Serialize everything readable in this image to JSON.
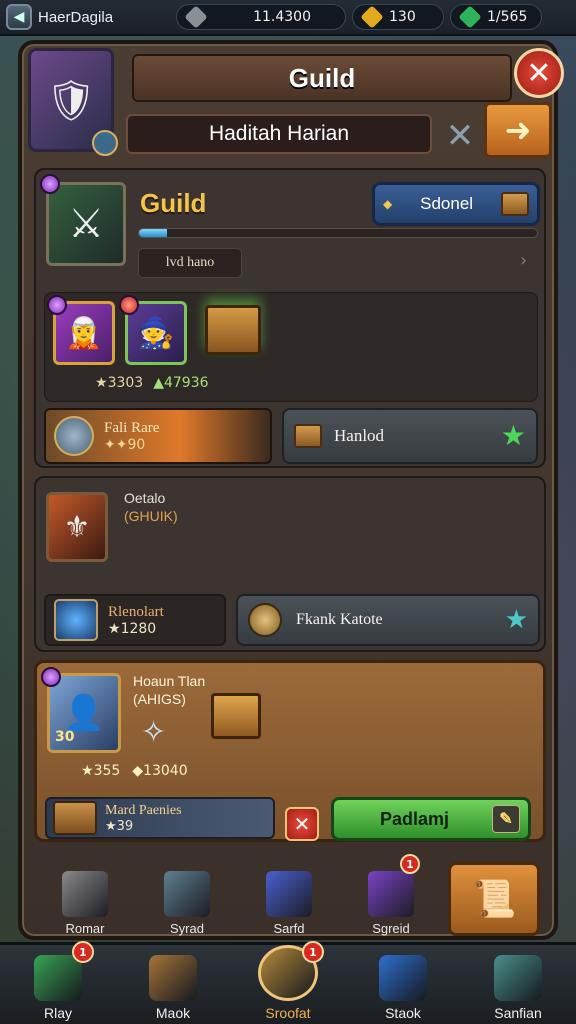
{
  "topbar": {
    "player_name": "HaerDagila",
    "currency_main": "11.4300",
    "gold": "130",
    "gems": "1/565"
  },
  "panel": {
    "title": "Guild",
    "subtitle": "Haditah Harian",
    "close_label": "✕",
    "next_label": "➜"
  },
  "guild": {
    "name": "Guild",
    "tag": "lvd hano",
    "select_label": "Sdonel",
    "progress": 0.07,
    "reward_stats": [
      "3303",
      "47936"
    ],
    "fame_title": "Fali Rare",
    "fame_value": "90",
    "claim_label": "Hanlod"
  },
  "details": {
    "title": "Oetalo",
    "subtitle": "(GHUIK)",
    "relic_name": "Rlenolart",
    "relic_value": "1280",
    "rank_label": "Fkank Katote"
  },
  "member": {
    "name": "Hoaun Tlan",
    "role": "(AHIGS)",
    "level": "30",
    "stats": [
      "355",
      "13040"
    ],
    "quest_title": "Mard Paenies",
    "quest_value": "39",
    "accept_label": "Padlamj"
  },
  "craft": [
    {
      "label": "Romar",
      "icon": "anvil-icon",
      "color": "#8a8a8a"
    },
    {
      "label": "Syrad",
      "icon": "crate-icon",
      "color": "#5f7f8f"
    },
    {
      "label": "Sarfd",
      "icon": "crystal-icon",
      "color": "#4a5fd0"
    },
    {
      "label": "Sgreid",
      "icon": "gem-icon",
      "color": "#7a43c6",
      "badge": "1"
    }
  ],
  "nav": [
    {
      "label": "Rlay",
      "icon": "home-icon",
      "color": "#3aa354",
      "badge": "1"
    },
    {
      "label": "Maok",
      "icon": "chest-icon",
      "color": "#a8743a"
    },
    {
      "label": "Sroofat",
      "icon": "guild-icon",
      "color": "#b58a3a",
      "badge": "1",
      "active": true
    },
    {
      "label": "Staok",
      "icon": "gem-icon",
      "color": "#2f6fd0"
    },
    {
      "label": "Sanfian",
      "icon": "tools-icon",
      "color": "#4b8f8c"
    }
  ],
  "colors": {
    "accent": "#f5c54a",
    "progress": "#2d8ec9",
    "accept": "#4fb73f"
  }
}
